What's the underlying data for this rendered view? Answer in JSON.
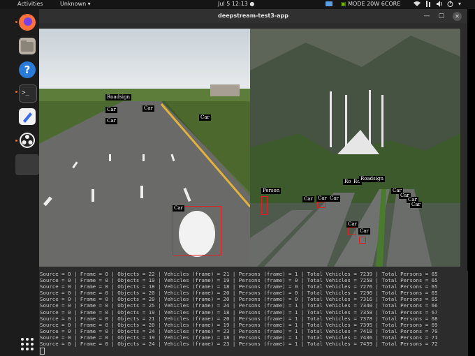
{
  "topbar": {
    "activities": "Activities",
    "app_menu": "Unknown",
    "clock": "Jul 5  12:13",
    "status_text": "MODE 20W 6CORE"
  },
  "dock": {
    "items": [
      "firefox",
      "files",
      "help",
      "terminal",
      "text-editor",
      "obs-studio",
      "app-grid"
    ]
  },
  "window": {
    "title": "deepstream-test3-app"
  },
  "detections": {
    "left": [
      "Roadsign",
      "Car",
      "Car",
      "Car",
      "Car",
      "Car"
    ],
    "right": [
      "Person",
      "Car",
      "Car",
      "Car",
      "Ro",
      "Ro",
      "Roadsign",
      "Car",
      "Car",
      "Car",
      "Car",
      "Car",
      "Car"
    ]
  },
  "terminal": {
    "lines": [
      "Source = 0 | Frame = 0 | Objects = 22 | Vehicles (frame) = 21 | Persons (frame) = 1 | Total Vehicles = 7239 | Total Persons = 65",
      "Source = 0 | Frame = 0 | Objects = 19 | Vehicles (frame) = 19 | Persons (frame) = 0 | Total Vehicles = 7258 | Total Persons = 65",
      "Source = 0 | Frame = 0 | Objects = 18 | Vehicles (frame) = 18 | Persons (frame) = 0 | Total Vehicles = 7276 | Total Persons = 65",
      "Source = 0 | Frame = 0 | Objects = 20 | Vehicles (frame) = 20 | Persons (frame) = 0 | Total Vehicles = 7296 | Total Persons = 65",
      "Source = 0 | Frame = 0 | Objects = 20 | Vehicles (frame) = 20 | Persons (frame) = 0 | Total Vehicles = 7316 | Total Persons = 65",
      "Source = 0 | Frame = 0 | Objects = 25 | Vehicles (frame) = 24 | Persons (frame) = 1 | Total Vehicles = 7340 | Total Persons = 66",
      "Source = 0 | Frame = 0 | Objects = 19 | Vehicles (frame) = 18 | Persons (frame) = 1 | Total Vehicles = 7358 | Total Persons = 67",
      "Source = 0 | Frame = 0 | Objects = 21 | Vehicles (frame) = 20 | Persons (frame) = 1 | Total Vehicles = 7378 | Total Persons = 68",
      "Source = 0 | Frame = 0 | Objects = 20 | Vehicles (frame) = 19 | Persons (frame) = 1 | Total Vehicles = 7395 | Total Persons = 69",
      "Source = 0 | Frame = 0 | Objects = 24 | Vehicles (frame) = 23 | Persons (frame) = 1 | Total Vehicles = 7418 | Total Persons = 70",
      "Source = 0 | Frame = 0 | Objects = 19 | Vehicles (frame) = 18 | Persons (frame) = 1 | Total Vehicles = 7436 | Total Persons = 71",
      "Source = 0 | Frame = 0 | Objects = 24 | Vehicles (frame) = 23 | Persons (frame) = 1 | Total Vehicles = 7459 | Total Persons = 72"
    ]
  }
}
